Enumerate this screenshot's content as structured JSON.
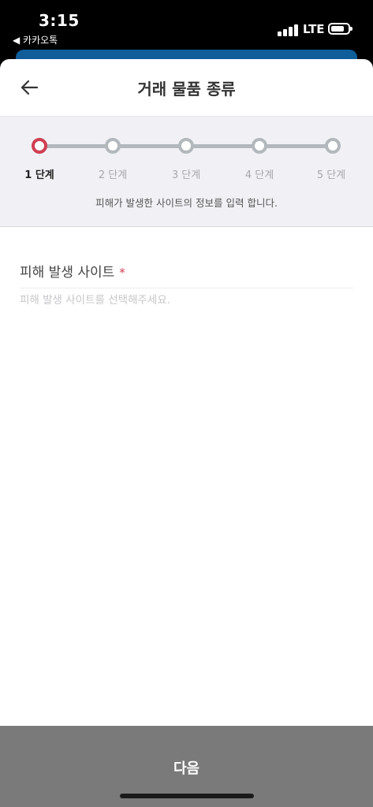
{
  "status_bar": {
    "time": "3:15",
    "back_app": "◀ 카카오톡",
    "network": "LTE"
  },
  "header": {
    "title": "거래 물품 종류"
  },
  "steps": {
    "items": [
      {
        "label": "1 단계",
        "active": true
      },
      {
        "label": "2 단계",
        "active": false
      },
      {
        "label": "3 단계",
        "active": false
      },
      {
        "label": "4 단계",
        "active": false
      },
      {
        "label": "5 단계",
        "active": false
      }
    ],
    "description": "피해가 발생한 사이트의 정보를 입력 합니다."
  },
  "form": {
    "site_label": "피해 발생 사이트",
    "required_mark": "*",
    "site_placeholder": "피해 발생 사이트를 선택해주세요.",
    "site_value": ""
  },
  "footer": {
    "next_label": "다음"
  },
  "colors": {
    "accent": "#cf3e52",
    "step_inactive": "#b2b8bc",
    "button_bg": "#7a7a7a",
    "under_sheet": "#0f5d99"
  }
}
